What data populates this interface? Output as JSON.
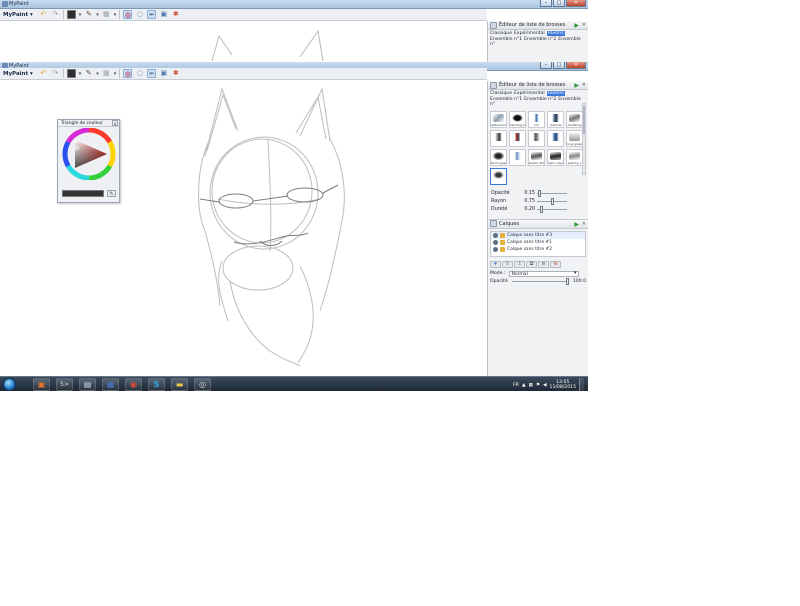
{
  "back_window": {
    "title": "MyPaint",
    "menu_label": "MyPaint ▾",
    "panel_title": "Éditeur de liste de brosses",
    "groups": [
      "Classique",
      "Expérimental",
      "Favoris",
      "Ensemble n°1",
      "Ensemble n°2",
      "Ensemble n°"
    ]
  },
  "window": {
    "title": "MyPaint",
    "menu_label": "MyPaint ▾",
    "controls": {
      "minimize": "–",
      "maximize": "□",
      "close": "✕"
    }
  },
  "toolbar": {
    "icons": [
      "undo-icon",
      "redo-icon",
      "color-swatch-icon",
      "brush-icon",
      "grid-icon",
      "eraser-icon",
      "circle-icon",
      "pen-icon",
      "image-icon",
      "multi-icon"
    ],
    "dropdown_glyph": "▾"
  },
  "brush_panel": {
    "title": "Éditeur de liste de brosses",
    "groups": [
      "Classique",
      "Expérimental",
      "Favoris",
      "Ensemble n°1",
      "Ensemble n°2",
      "Ensemble n°"
    ],
    "selected_group": "Favoris",
    "brushes": [
      {
        "label": "watercolor"
      },
      {
        "label": "blending bluest"
      },
      {
        "label": "ink"
      },
      {
        "label": "charcoal"
      },
      {
        "label": "modelling"
      },
      {
        "label": ""
      },
      {
        "label": ""
      },
      {
        "label": ""
      },
      {
        "label": ""
      },
      {
        "label": "long grass"
      },
      {
        "label": "short grass"
      },
      {
        "label": ""
      },
      {
        "label": "sketch dirt 1"
      },
      {
        "label": "dark-crayon"
      },
      {
        "label": "sketchy 1"
      },
      {
        "label": ""
      }
    ],
    "sliders": [
      {
        "label": "Opacité",
        "value": "0.15",
        "pos": 0.05
      },
      {
        "label": "Rayon",
        "value": "0.75",
        "pos": 0.5
      },
      {
        "label": "Dureté",
        "value": "0.20",
        "pos": 0.1
      }
    ]
  },
  "layers_panel": {
    "title": "Calques",
    "layers": [
      "Calque sans titre #3",
      "Calque sans titre #1",
      "Calque sans titre #2"
    ],
    "buttons": [
      "+",
      "⇧",
      "⇩",
      "⧉",
      "≡",
      "⊖"
    ],
    "mode_label": "Mode :",
    "mode_value": "Normal",
    "opacity_label": "Opacité",
    "opacity_value": "100.0"
  },
  "colour_triangle": {
    "title": "Triangle de couleur",
    "close": "x",
    "picker_glyph": "✎",
    "current_color": "#333333"
  },
  "taskbar": {
    "apps": [
      "start-orb",
      "office-icon",
      "terminal-icon",
      "explorer-icon",
      "word-icon",
      "chrome-icon",
      "skype-icon",
      "folder-icon",
      "mypaint-icon"
    ],
    "lang": "FR",
    "time": "13:05",
    "date": "11/08/2015"
  }
}
